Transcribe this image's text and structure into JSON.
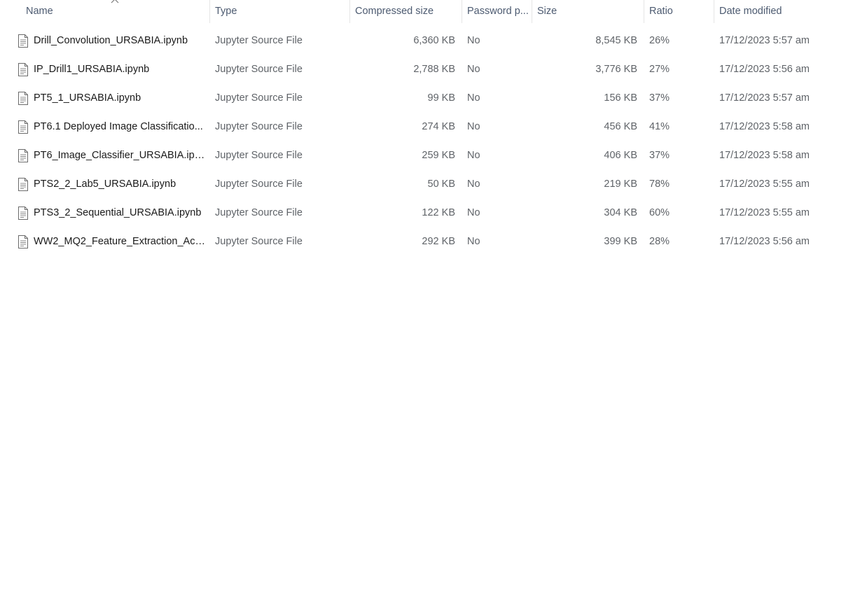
{
  "columns": {
    "name": "Name",
    "type": "Type",
    "compressed_size": "Compressed size",
    "password": "Password p...",
    "size": "Size",
    "ratio": "Ratio",
    "date_modified": "Date modified"
  },
  "sort": {
    "column": "name",
    "direction": "ascending",
    "icon": "chevron-up-icon"
  },
  "file_icon": "document-icon",
  "files": [
    {
      "name": "Drill_Convolution_URSABIA.ipynb",
      "type": "Jupyter Source File",
      "compressed_size": "6,360 KB",
      "password": "No",
      "size": "8,545 KB",
      "ratio": "26%",
      "date_modified": "17/12/2023 5:57 am"
    },
    {
      "name": "IP_Drill1_URSABIA.ipynb",
      "type": "Jupyter Source File",
      "compressed_size": "2,788 KB",
      "password": "No",
      "size": "3,776 KB",
      "ratio": "27%",
      "date_modified": "17/12/2023 5:56 am"
    },
    {
      "name": "PT5_1_URSABIA.ipynb",
      "type": "Jupyter Source File",
      "compressed_size": "99 KB",
      "password": "No",
      "size": "156 KB",
      "ratio": "37%",
      "date_modified": "17/12/2023 5:57 am"
    },
    {
      "name": "PT6.1 Deployed Image Classificatio...",
      "type": "Jupyter Source File",
      "compressed_size": "274 KB",
      "password": "No",
      "size": "456 KB",
      "ratio": "41%",
      "date_modified": "17/12/2023 5:58 am"
    },
    {
      "name": "PT6_Image_Classifier_URSABIA.ipy...",
      "type": "Jupyter Source File",
      "compressed_size": "259 KB",
      "password": "No",
      "size": "406 KB",
      "ratio": "37%",
      "date_modified": "17/12/2023 5:58 am"
    },
    {
      "name": "PTS2_2_Lab5_URSABIA.ipynb",
      "type": "Jupyter Source File",
      "compressed_size": "50 KB",
      "password": "No",
      "size": "219 KB",
      "ratio": "78%",
      "date_modified": "17/12/2023 5:55 am"
    },
    {
      "name": "PTS3_2_Sequential_URSABIA.ipynb",
      "type": "Jupyter Source File",
      "compressed_size": "122 KB",
      "password": "No",
      "size": "304 KB",
      "ratio": "60%",
      "date_modified": "17/12/2023 5:55 am"
    },
    {
      "name": "WW2_MQ2_Feature_Extraction_Acti...",
      "type": "Jupyter Source File",
      "compressed_size": "292 KB",
      "password": "No",
      "size": "399 KB",
      "ratio": "28%",
      "date_modified": "17/12/2023 5:56 am"
    }
  ]
}
